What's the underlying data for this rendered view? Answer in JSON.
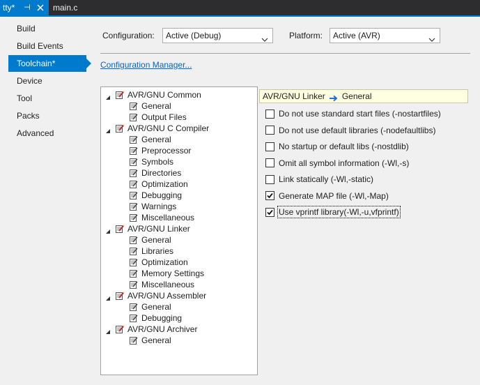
{
  "tabs": {
    "active_title": "tty*",
    "pin_glyph": "⊣",
    "other_title": "main.c"
  },
  "sidebar": {
    "items": [
      {
        "label": "Build",
        "active": false
      },
      {
        "label": "Build Events",
        "active": false
      },
      {
        "label": "Toolchain*",
        "active": true
      },
      {
        "label": "Device",
        "active": false
      },
      {
        "label": "Tool",
        "active": false
      },
      {
        "label": "Packs",
        "active": false
      },
      {
        "label": "Advanced",
        "active": false
      }
    ]
  },
  "config": {
    "configuration_label": "Configuration:",
    "configuration_value": "Active (Debug)",
    "platform_label": "Platform:",
    "platform_value": "Active (AVR)",
    "manager_link": "Configuration Manager..."
  },
  "tree": {
    "groups": [
      {
        "label": "AVR/GNU Common",
        "children": [
          "General",
          "Output Files"
        ]
      },
      {
        "label": "AVR/GNU C Compiler",
        "children": [
          "General",
          "Preprocessor",
          "Symbols",
          "Directories",
          "Optimization",
          "Debugging",
          "Warnings",
          "Miscellaneous"
        ]
      },
      {
        "label": "AVR/GNU Linker",
        "children": [
          "General",
          "Libraries",
          "Optimization",
          "Memory Settings",
          "Miscellaneous"
        ]
      },
      {
        "label": "AVR/GNU Assembler",
        "children": [
          "General",
          "Debugging"
        ]
      },
      {
        "label": "AVR/GNU Archiver",
        "children": [
          "General"
        ]
      }
    ]
  },
  "panel": {
    "header_section": "AVR/GNU Linker",
    "header_page": "General",
    "options": [
      {
        "label": "Do not use standard start files (-nostartfiles)",
        "checked": false
      },
      {
        "label": "Do not use default libraries (-nodefaultlibs)",
        "checked": false
      },
      {
        "label": "No startup or default libs (-nostdlib)",
        "checked": false
      },
      {
        "label": "Omit all symbol information (-Wl,-s)",
        "checked": false
      },
      {
        "label": "Link statically (-Wl,-static)",
        "checked": false
      },
      {
        "label": "Generate MAP file (-Wl,-Map)",
        "checked": true
      },
      {
        "label": "Use vprintf library(-Wl,-u,vfprintf)",
        "checked": true,
        "focused": true
      }
    ]
  },
  "colors": {
    "accent": "#007acc",
    "tab_strip": "#2d2d30",
    "link": "#0066cc",
    "header_bg": "#ffffe1"
  }
}
